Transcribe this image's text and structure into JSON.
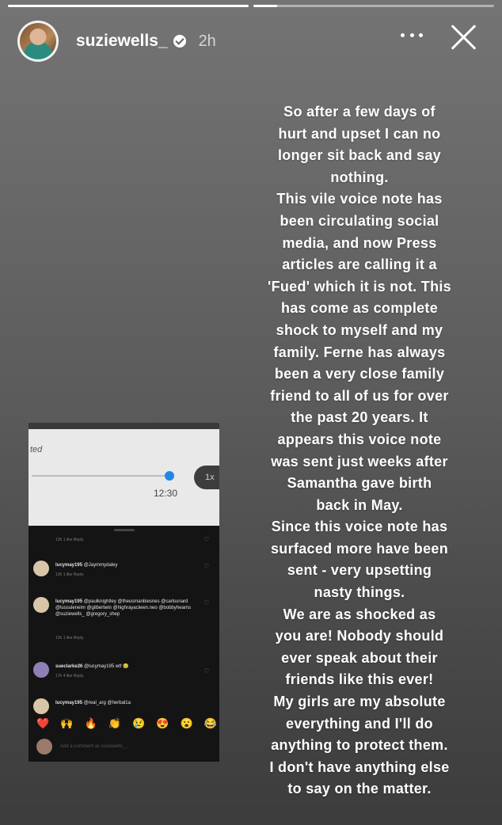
{
  "progress": [
    1.0,
    0.1
  ],
  "header": {
    "username": "suziewells_",
    "time": "2h"
  },
  "icons": {
    "verified": "verified-badge-icon",
    "more": "more-options-icon",
    "close": "close-icon"
  },
  "caption_lines": [
    "So after a few days of",
    "hurt and upset I can no",
    "longer sit back and say",
    "nothing.",
    "This vile voice note has",
    "been circulating social",
    "media, and now Press",
    "articles are calling it a",
    "'Fued' which it is not. This",
    "has come as complete",
    "shock to myself and my",
    "family. Ferne has always",
    "been a very close family",
    "friend to all of us for over",
    "the past 20 years. It",
    "appears this voice note",
    "was sent just weeks after",
    "Samantha gave birth",
    "back in May.",
    "Since this voice note has",
    "surfaced more have been",
    "sent - very upsetting",
    "nasty things.",
    "We are as shocked as",
    "you are! Nobody should",
    "ever speak about their",
    "friends like this ever!",
    "My girls are my absolute",
    "everything and I'll do",
    "anything to protect them.",
    "I don't have anything else",
    "to say on the matter."
  ],
  "screenshot": {
    "partial_label": "ted",
    "audio": {
      "duration": "12:30",
      "speed": "1x",
      "progress": 0.95
    },
    "comments": [
      {
        "user": "lucymay195",
        "text": "@Jaymmydaley",
        "meta": "13h   1 like   Reply"
      },
      {
        "user": "lucymay195",
        "text": "@paulknightley @theusmanbiesnes @carlsunard @lussuleneim @gilbertwin @highrayaclwen.neo @bobbyhearns @suziewells_ @gregory_shep",
        "meta": "13h   1 like   Reply"
      },
      {
        "user": "sueclarke26",
        "text": "@lucymay195 wtf 😥",
        "meta": "17h   4 like   Reply"
      },
      {
        "user": "lucymay195",
        "text": "@real_arg @herbal1a",
        "meta": ""
      }
    ],
    "first_meta": "13h   1 like   Reply",
    "reactions": [
      "❤️",
      "🙌",
      "🔥",
      "👏",
      "😢",
      "😍",
      "😮",
      "😂"
    ],
    "comment_placeholder": "Add a comment as suziewells_..."
  }
}
